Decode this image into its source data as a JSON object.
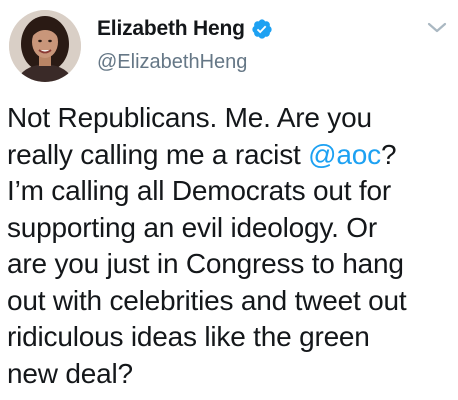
{
  "author": {
    "display_name": "Elizabeth Heng",
    "handle": "@ElizabethHeng",
    "verified": true,
    "verified_icon": "verified-badge-icon",
    "avatar_icon": "profile-photo"
  },
  "menu": {
    "icon": "chevron-down-icon"
  },
  "tweet": {
    "lines": [
      {
        "before": "Not Republicans. Me. Are you",
        "mention": "",
        "after": ""
      },
      {
        "before": "really calling me a racist ",
        "mention": "@aoc",
        "after": "?"
      },
      {
        "before": "I’m calling all Democrats out for",
        "mention": "",
        "after": ""
      },
      {
        "before": "supporting an evil ideology. Or",
        "mention": "",
        "after": ""
      },
      {
        "before": "are you just in Congress to hang",
        "mention": "",
        "after": ""
      },
      {
        "before": "out with celebrities and tweet out",
        "mention": "",
        "after": ""
      },
      {
        "before": "ridiculous ideas like the green",
        "mention": "",
        "after": ""
      },
      {
        "before": "new deal?",
        "mention": "",
        "after": ""
      }
    ]
  },
  "colors": {
    "text": "#14171a",
    "secondary": "#657786",
    "link": "#1da1f2",
    "verified": "#1da1f2",
    "chevron": "#aab8c2"
  }
}
